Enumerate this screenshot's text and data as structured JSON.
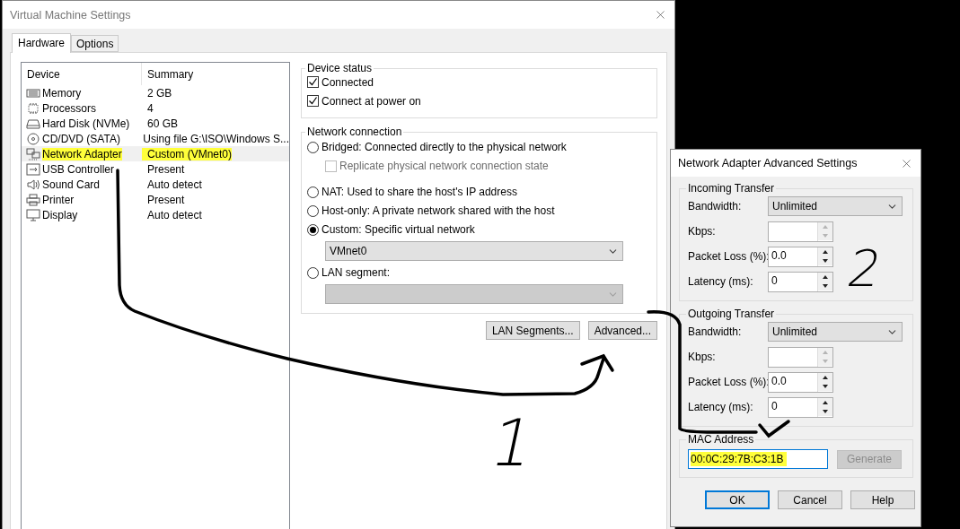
{
  "window": {
    "title": "Virtual Machine Settings"
  },
  "tabs": [
    {
      "label": "Hardware",
      "selected": true
    },
    {
      "label": "Options",
      "selected": false
    }
  ],
  "device_list": {
    "columns": [
      "Device",
      "Summary"
    ],
    "rows": [
      {
        "kind": "memory",
        "device": "Memory",
        "summary": "2 GB",
        "selected": false,
        "highlighted": false
      },
      {
        "kind": "cpu",
        "device": "Processors",
        "summary": "4",
        "selected": false,
        "highlighted": false
      },
      {
        "kind": "disk",
        "device": "Hard Disk (NVMe)",
        "summary": "60 GB",
        "selected": false,
        "highlighted": false
      },
      {
        "kind": "cd",
        "device": "CD/DVD (SATA)",
        "summary": "Using file G:\\ISO\\Windows S...",
        "selected": false,
        "highlighted": false
      },
      {
        "kind": "network",
        "device": "Network Adapter",
        "summary": "Custom (VMnet0)",
        "selected": true,
        "highlighted": true
      },
      {
        "kind": "usb",
        "device": "USB Controller",
        "summary": "Present",
        "selected": false,
        "highlighted": false
      },
      {
        "kind": "sound",
        "device": "Sound Card",
        "summary": "Auto detect",
        "selected": false,
        "highlighted": false
      },
      {
        "kind": "printer",
        "device": "Printer",
        "summary": "Present",
        "selected": false,
        "highlighted": false
      },
      {
        "kind": "display",
        "device": "Display",
        "summary": "Auto detect",
        "selected": false,
        "highlighted": false
      }
    ]
  },
  "device_status": {
    "title": "Device status",
    "options": [
      {
        "label": "Connected",
        "checked": true
      },
      {
        "label": "Connect at power on",
        "checked": true
      }
    ]
  },
  "network_connection": {
    "title": "Network connection",
    "options": [
      {
        "kind": "radio",
        "label": "Bridged: Connected directly to the physical network",
        "selected": false
      },
      {
        "kind": "checkbox",
        "label": "Replicate physical network connection state",
        "checked": false,
        "disabled": true
      },
      {
        "kind": "radio",
        "label": "NAT: Used to share the host's IP address",
        "selected": false
      },
      {
        "kind": "radio",
        "label": "Host-only: A private network shared with the host",
        "selected": false
      },
      {
        "kind": "radio",
        "label": "Custom: Specific virtual network",
        "selected": true
      },
      {
        "kind": "dropdown",
        "value": "VMnet0",
        "disabled": false
      },
      {
        "kind": "radio",
        "label": "LAN segment:",
        "selected": false
      },
      {
        "kind": "dropdown",
        "disabled": true
      }
    ]
  },
  "buttons": [
    "LAN Segments...",
    "Advanced..."
  ],
  "advanced_dialog": {
    "title": "Network Adapter Advanced Settings",
    "groups": [
      {
        "title": "Incoming Transfer",
        "fields": [
          {
            "kind": "dropdown",
            "label": "Bandwidth:",
            "value": "Unlimited"
          },
          {
            "kind": "spin",
            "label": "Kbps:",
            "disabled": true
          },
          {
            "kind": "spin",
            "label": "Packet Loss (%):",
            "value": "0.0",
            "disabled": false
          },
          {
            "kind": "spin",
            "label": "Latency (ms):",
            "value": "0",
            "disabled": false
          }
        ]
      },
      {
        "title": "Outgoing Transfer",
        "fields": [
          {
            "kind": "dropdown",
            "label": "Bandwidth:",
            "value": "Unlimited"
          },
          {
            "kind": "spin",
            "label": "Kbps:",
            "disabled": true
          },
          {
            "kind": "spin",
            "label": "Packet Loss (%):",
            "value": "0.0",
            "disabled": false
          },
          {
            "kind": "spin",
            "label": "Latency (ms):",
            "value": "0",
            "disabled": false
          }
        ]
      }
    ],
    "mac": {
      "title": "MAC Address",
      "value": "00:0C:29:7B:C3:1B",
      "highlighted": true
    },
    "generate": {
      "label": "Generate",
      "disabled": true
    },
    "buttons": [
      {
        "label": "OK",
        "default": true
      },
      {
        "label": "Cancel",
        "default": false
      },
      {
        "label": "Help",
        "default": false
      }
    ]
  },
  "annotations": [
    {
      "label": "1"
    },
    {
      "label": "2"
    }
  ]
}
